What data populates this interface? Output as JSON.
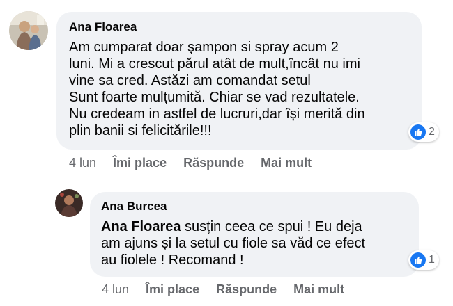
{
  "comments": [
    {
      "author": "Ana Floarea",
      "lines": [
        "Am cumparat doar șampon si spray acum 2",
        "luni. Mi a crescut părul atât de mult,încât nu imi",
        "vine sa cred. Astăzi am comandat setul",
        "Sunt foarte mulțumită. Chiar se vad rezultatele.",
        "Nu credeam in astfel de lucruri,dar își merită din",
        "plin banii si felicitările!!!"
      ],
      "reaction_icon": "like-icon",
      "reaction_count": "2",
      "time": "4 lun",
      "like_label": "Îmi place",
      "reply_label": "Răspunde",
      "more_label": "Mai mult"
    },
    {
      "author": "Ana Burcea",
      "mention": "Ana Floarea",
      "line1_rest": " susțin ceea ce spui ! Eu deja",
      "lines": [
        "am ajuns și la setul cu fiole sa văd ce efect",
        "au fiolele ! Recomand !"
      ],
      "reaction_icon": "like-icon",
      "reaction_count": "1",
      "time": "4 lun",
      "like_label": "Îmi place",
      "reply_label": "Răspunde",
      "more_label": "Mai mult"
    }
  ],
  "colors": {
    "bubble": "#f0f2f5",
    "like_blue": "#1877f2",
    "meta_gray": "#65676b"
  }
}
